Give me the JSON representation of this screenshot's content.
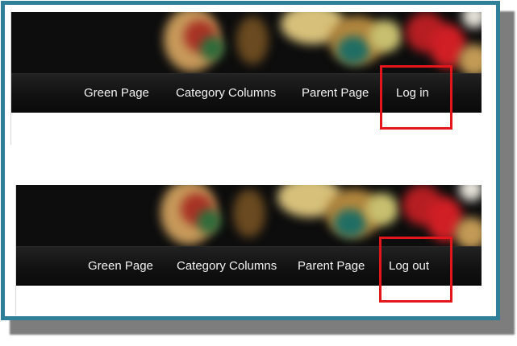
{
  "panels": [
    {
      "nav_items": [
        {
          "label": "Green Page"
        },
        {
          "label": "Category Columns"
        },
        {
          "label": "Parent Page"
        },
        {
          "label": "Log in"
        }
      ],
      "highlighted_item": "Log in"
    },
    {
      "nav_items": [
        {
          "label": "Green Page"
        },
        {
          "label": "Category Columns"
        },
        {
          "label": "Parent Page"
        },
        {
          "label": "Log out"
        }
      ],
      "highlighted_item": "Log out"
    }
  ],
  "colors": {
    "frame_border": "#2f7f99",
    "nav_background": "#111111",
    "nav_text": "#f2f2f2",
    "highlight": "#e3161b"
  }
}
